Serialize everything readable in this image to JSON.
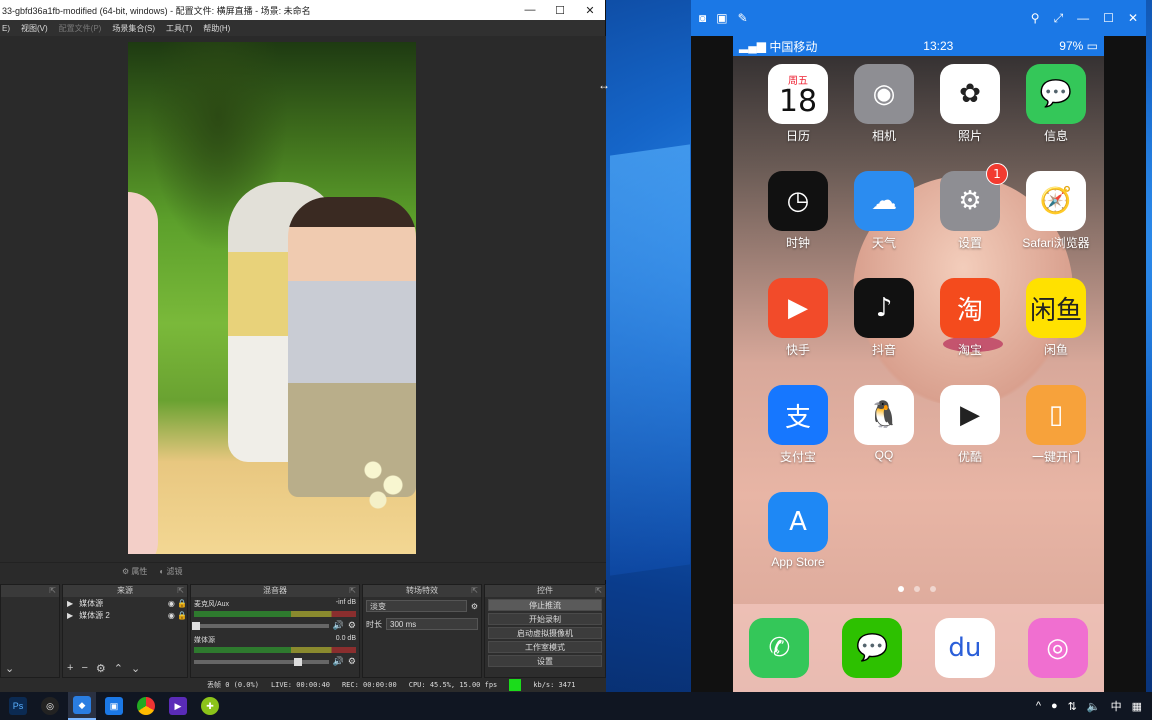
{
  "obs": {
    "title": "33-gbfd36a1fb-modified (64-bit, windows) - 配置文件: 横屏直播 - 场景: 未命名",
    "menu": {
      "file": "E)",
      "view": "视图(V)",
      "profile": "配置文件(P)",
      "scene_collection": "场景集合(S)",
      "tools": "工具(T)",
      "help": "帮助(H)"
    },
    "source_toolbar": {
      "properties": "属性",
      "filters": "滤镜"
    },
    "docks": {
      "sources": "来源",
      "mixer": "混音器",
      "transitions": "转场特效",
      "controls": "控件"
    },
    "sources": [
      {
        "name": "媒体源"
      },
      {
        "name": "媒体源 2"
      }
    ],
    "mixer": [
      {
        "name": "麦克风/Aux",
        "level": "-inf dB"
      },
      {
        "name": "媒体源",
        "level": "0.0 dB"
      }
    ],
    "transition": {
      "name": "淡变",
      "duration_label": "时长",
      "duration_value": "300 ms"
    },
    "controls": {
      "stop_stream": "停止推流",
      "start_record": "开始录制",
      "virtual_cam": "启动虚拟摄像机",
      "studio_mode": "工作室模式",
      "settings": "设置"
    },
    "status": {
      "dropped": "丢帧 0 (0.0%)",
      "live": "LIVE: 00:00:40",
      "rec": "REC: 00:00:00",
      "cpu": "CPU: 45.5%, 15.00 fps",
      "kbps": "kb/s: 3471"
    }
  },
  "mirror": {
    "statusbar": {
      "carrier": "中国移动",
      "time": "13:23",
      "battery": "97%"
    },
    "apps": [
      {
        "label": "日历",
        "weekday": "周五",
        "day": "18",
        "bg": "#ffffff",
        "icon": "calendar-icon"
      },
      {
        "label": "相机",
        "glyph": "◉",
        "bg": "#8e8e93",
        "icon": "camera-icon"
      },
      {
        "label": "照片",
        "glyph": "✿",
        "bg": "#ffffff",
        "icon": "photos-icon"
      },
      {
        "label": "信息",
        "glyph": "💬",
        "bg": "#34c759",
        "icon": "messages-icon"
      },
      {
        "label": "时钟",
        "glyph": "◷",
        "bg": "#111111",
        "icon": "clock-icon"
      },
      {
        "label": "天气",
        "glyph": "☁",
        "bg": "#2b8cf0",
        "icon": "weather-icon"
      },
      {
        "label": "设置",
        "glyph": "⚙",
        "bg": "#8e8e93",
        "icon": "settings-icon",
        "badge": "1"
      },
      {
        "label": "Safari浏览器",
        "glyph": "🧭",
        "bg": "#ffffff",
        "icon": "safari-icon"
      },
      {
        "label": "快手",
        "glyph": "▶",
        "bg": "#f24b2a",
        "icon": "kuaishou-icon"
      },
      {
        "label": "抖音",
        "glyph": "♪",
        "bg": "#111111",
        "icon": "douyin-icon"
      },
      {
        "label": "淘宝",
        "glyph": "淘",
        "bg": "#f44b1d",
        "icon": "taobao-icon"
      },
      {
        "label": "闲鱼",
        "glyph": "闲鱼",
        "bg": "#ffe100",
        "icon": "xianyu-icon"
      },
      {
        "label": "支付宝",
        "glyph": "支",
        "bg": "#1677ff",
        "icon": "alipay-icon"
      },
      {
        "label": "QQ",
        "glyph": "🐧",
        "bg": "#ffffff",
        "icon": "qq-icon"
      },
      {
        "label": "优酷",
        "glyph": "▶",
        "bg": "#ffffff",
        "icon": "youku-icon"
      },
      {
        "label": "一键开门",
        "glyph": "▯",
        "bg": "#f7a23b",
        "icon": "door-icon"
      },
      {
        "label": "App Store",
        "glyph": "A",
        "bg": "#1e88f5",
        "icon": "appstore-icon"
      }
    ],
    "dock": [
      {
        "glyph": "✆",
        "bg": "#34c759",
        "icon": "phone-icon"
      },
      {
        "glyph": "💬",
        "bg": "#2dc100",
        "icon": "wechat-icon"
      },
      {
        "glyph": "du",
        "bg": "#ffffff",
        "icon": "baidu-icon"
      },
      {
        "glyph": "◎",
        "bg": "#f06fd0",
        "icon": "camera-beauty-icon"
      }
    ]
  },
  "taskbar": {
    "tray_time": "中"
  }
}
